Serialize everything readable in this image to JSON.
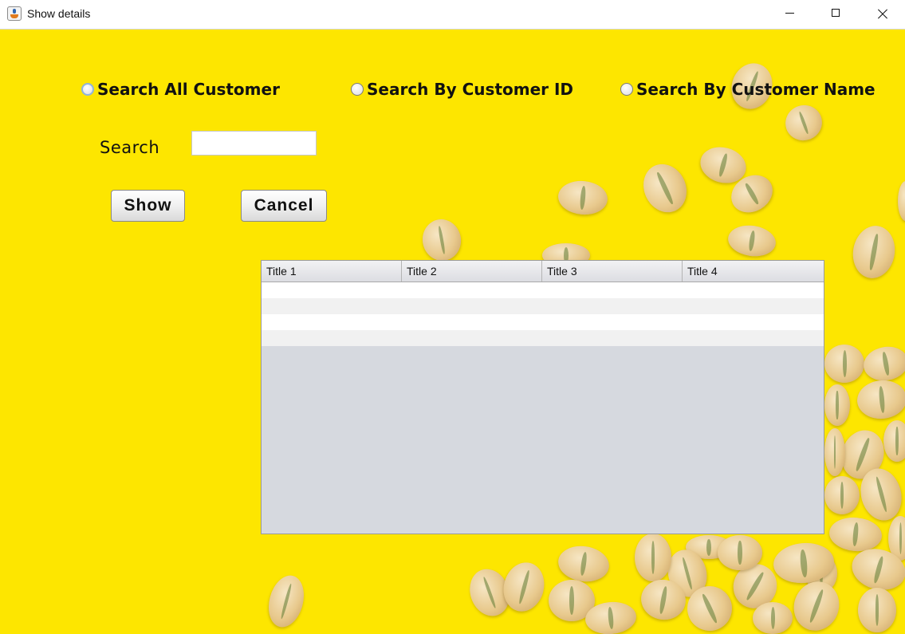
{
  "window": {
    "title": "Show details",
    "icon": "java-app-icon",
    "controls": [
      "minimize-icon",
      "maximize-icon",
      "close-icon"
    ]
  },
  "search_options": {
    "all_label": "Search All Customer",
    "by_id_label": "Search By Customer ID",
    "by_name_label": "Search By Customer Name"
  },
  "search": {
    "label": "Search",
    "value": "",
    "placeholder": ""
  },
  "buttons": {
    "show_label": "Show",
    "cancel_label": "Cancel"
  },
  "table": {
    "columns": [
      "Title 1",
      "Title 2",
      "Title 3",
      "Title 4"
    ],
    "rows": [
      [
        "",
        "",
        "",
        ""
      ],
      [
        "",
        "",
        "",
        ""
      ],
      [
        "",
        "",
        "",
        ""
      ],
      [
        "",
        "",
        "",
        ""
      ]
    ]
  },
  "colors": {
    "background": "#fde600",
    "table_empty_area": "#d6d9df"
  }
}
